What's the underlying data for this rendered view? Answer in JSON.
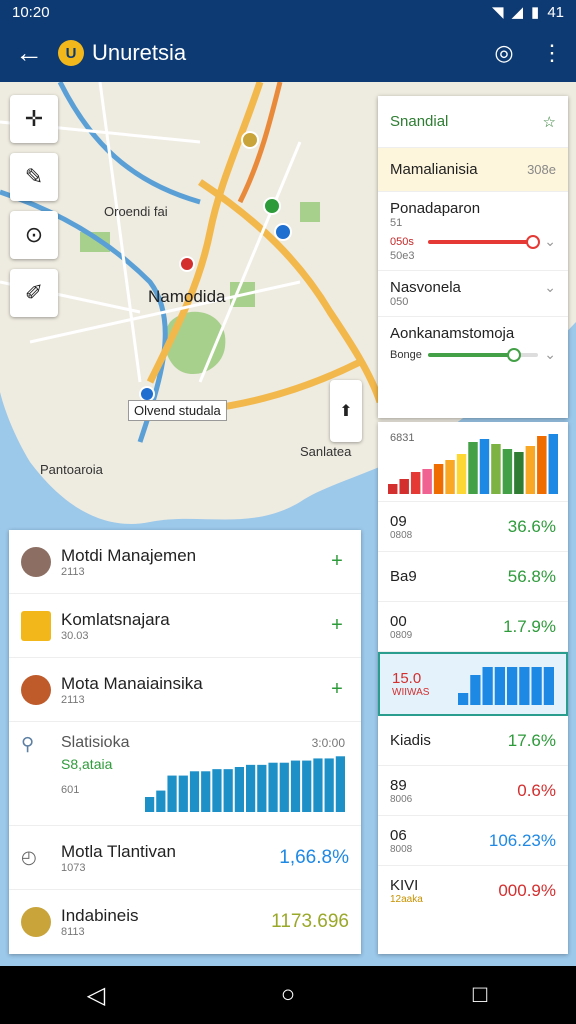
{
  "status_bar": {
    "time": "10:20",
    "battery": "41"
  },
  "app_bar": {
    "title": "Unuretsia",
    "logo": "U"
  },
  "map": {
    "labels": [
      "Oroendi fai",
      "Namodida",
      "Sanlatea",
      "Pantoaroia"
    ],
    "callout": "Olvend studala",
    "colors": {
      "water": "#9cc8ea",
      "park": "#a8d08d",
      "road_major": "#f2b84b",
      "road_minor": "#ffffff",
      "canal": "#5aa0d6"
    }
  },
  "layers_panel": {
    "header": "Snandial",
    "search": {
      "label": "Mamalianisia",
      "count": "308e"
    },
    "rows": [
      {
        "name": "Ponadaparon",
        "sub": "51",
        "slider_value": "050s",
        "slider_sub": "50e3",
        "level": 0.95,
        "color": "#e53935"
      },
      {
        "name": "Nasvonela",
        "sub": "050"
      },
      {
        "name": "Aonkanamstomoja",
        "slider_value": "Bonge",
        "level": 0.78,
        "color": "#43a047"
      }
    ]
  },
  "stats_panel": {
    "chart_label": "6831",
    "chart_data": {
      "type": "bar",
      "categories": [
        "1",
        "2",
        "3",
        "4",
        "5",
        "6",
        "7",
        "8",
        "9",
        "10",
        "11",
        "12",
        "13",
        "14",
        "15"
      ],
      "values": [
        10,
        15,
        22,
        25,
        30,
        34,
        40,
        52,
        55,
        50,
        45,
        42,
        48,
        58,
        60
      ],
      "colors": [
        "#d32f2f",
        "#d32f2f",
        "#e53935",
        "#f06292",
        "#ef6c00",
        "#f9a825",
        "#fdd835",
        "#43a047",
        "#1e88e5",
        "#7cb342",
        "#43a047",
        "#2e7d32",
        "#f9a825",
        "#ef6c00",
        "#1e88e5"
      ]
    },
    "rows": [
      {
        "label": "09",
        "sub": "0808",
        "value": "36.6%",
        "tone": "green"
      },
      {
        "label": "Ba9",
        "sub": "",
        "value": "56.8%",
        "tone": "green"
      },
      {
        "label": "00",
        "sub": "0809",
        "value": "1.7.9%",
        "tone": "green"
      },
      {
        "label": "Kiadis",
        "sub": "",
        "value": "17.6%",
        "tone": "green"
      },
      {
        "label": "89",
        "sub": "8006",
        "value": "0.6%",
        "tone": "red"
      },
      {
        "label": "06",
        "sub": "8008",
        "value": "106.23%",
        "tone": "blue"
      },
      {
        "label": "KIVI",
        "sub": "12aaka",
        "value": "000.9%",
        "tone": "red"
      }
    ],
    "highlight": {
      "label": "15.0",
      "sub": "WIIWAS",
      "chart_data": {
        "type": "bar",
        "categories": [
          "1",
          "2",
          "3",
          "4",
          "5",
          "6",
          "7",
          "8"
        ],
        "values": [
          12,
          30,
          38,
          38,
          38,
          38,
          38,
          38
        ]
      }
    }
  },
  "list": {
    "items": [
      {
        "title": "Motdi Manajemen",
        "sub": "2113",
        "avatar": "#8d6e63"
      },
      {
        "title": "Komlatsnajara",
        "sub": "30.03",
        "avatar": "#f2b81b"
      },
      {
        "title": "Mota Manaiainsika",
        "sub": "2113",
        "avatar": "#bf5b2b"
      }
    ],
    "stats": {
      "title": "Slatisioka",
      "green": "S8,ataia",
      "sub": "601",
      "corner": "3:0:00",
      "chart_data": {
        "type": "bar",
        "categories": [
          "1",
          "2",
          "3",
          "4",
          "5",
          "6",
          "7",
          "8",
          "9",
          "10",
          "11",
          "12",
          "13",
          "14",
          "15",
          "16",
          "17",
          "18"
        ],
        "values": [
          14,
          20,
          34,
          34,
          38,
          38,
          40,
          40,
          42,
          44,
          44,
          46,
          46,
          48,
          48,
          50,
          50,
          52
        ]
      }
    },
    "bottom": [
      {
        "title": "Motla Tlantivan",
        "sub": "1073",
        "value": "1,66.8%",
        "tone": "blue"
      },
      {
        "title": "Indabineis",
        "sub": "8113",
        "value": "1173.696",
        "tone": "olive"
      }
    ]
  },
  "nav": {
    "back": "◁",
    "home": "○",
    "recent": "□"
  }
}
